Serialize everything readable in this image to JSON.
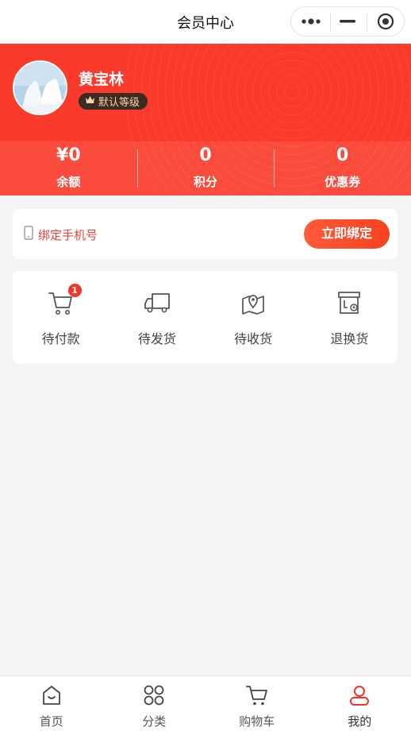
{
  "header": {
    "title": "会员中心"
  },
  "profile": {
    "name": "黄宝林",
    "level": "默认等级"
  },
  "stats": [
    {
      "value": "¥0",
      "label": "余额"
    },
    {
      "value": "0",
      "label": "积分"
    },
    {
      "value": "0",
      "label": "优惠券"
    }
  ],
  "bind": {
    "label": "绑定手机号",
    "button": "立即绑定"
  },
  "orders": [
    {
      "label": "待付款",
      "badge": "1",
      "icon": "cart-icon"
    },
    {
      "label": "待发货",
      "icon": "truck-icon"
    },
    {
      "label": "待收货",
      "icon": "map-pin-icon"
    },
    {
      "label": "退换货",
      "icon": "return-box-icon"
    }
  ],
  "tabbar": [
    {
      "label": "首页",
      "icon": "home-icon"
    },
    {
      "label": "分类",
      "icon": "category-icon"
    },
    {
      "label": "购物车",
      "icon": "cart-icon"
    },
    {
      "label": "我的",
      "icon": "user-icon",
      "active": true
    }
  ],
  "colors": {
    "accent": "#fa3a2a",
    "active_tab": "#f2362a",
    "badge_bg": "#3b2b22"
  }
}
